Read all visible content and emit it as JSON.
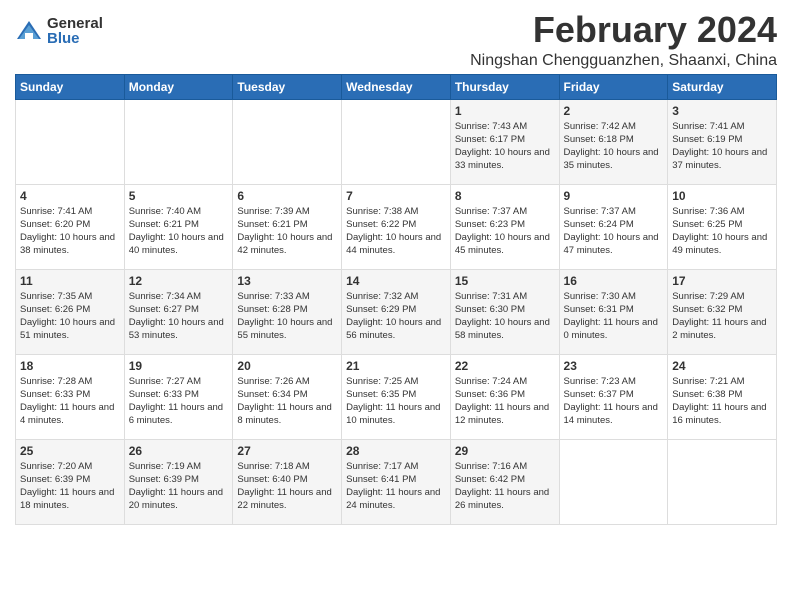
{
  "logo": {
    "general": "General",
    "blue": "Blue"
  },
  "title": "February 2024",
  "location": "Ningshan Chengguanzhen, Shaanxi, China",
  "weekdays": [
    "Sunday",
    "Monday",
    "Tuesday",
    "Wednesday",
    "Thursday",
    "Friday",
    "Saturday"
  ],
  "weeks": [
    [
      {
        "day": "",
        "info": ""
      },
      {
        "day": "",
        "info": ""
      },
      {
        "day": "",
        "info": ""
      },
      {
        "day": "",
        "info": ""
      },
      {
        "day": "1",
        "info": "Sunrise: 7:43 AM\nSunset: 6:17 PM\nDaylight: 10 hours and 33 minutes."
      },
      {
        "day": "2",
        "info": "Sunrise: 7:42 AM\nSunset: 6:18 PM\nDaylight: 10 hours and 35 minutes."
      },
      {
        "day": "3",
        "info": "Sunrise: 7:41 AM\nSunset: 6:19 PM\nDaylight: 10 hours and 37 minutes."
      }
    ],
    [
      {
        "day": "4",
        "info": "Sunrise: 7:41 AM\nSunset: 6:20 PM\nDaylight: 10 hours and 38 minutes."
      },
      {
        "day": "5",
        "info": "Sunrise: 7:40 AM\nSunset: 6:21 PM\nDaylight: 10 hours and 40 minutes."
      },
      {
        "day": "6",
        "info": "Sunrise: 7:39 AM\nSunset: 6:21 PM\nDaylight: 10 hours and 42 minutes."
      },
      {
        "day": "7",
        "info": "Sunrise: 7:38 AM\nSunset: 6:22 PM\nDaylight: 10 hours and 44 minutes."
      },
      {
        "day": "8",
        "info": "Sunrise: 7:37 AM\nSunset: 6:23 PM\nDaylight: 10 hours and 45 minutes."
      },
      {
        "day": "9",
        "info": "Sunrise: 7:37 AM\nSunset: 6:24 PM\nDaylight: 10 hours and 47 minutes."
      },
      {
        "day": "10",
        "info": "Sunrise: 7:36 AM\nSunset: 6:25 PM\nDaylight: 10 hours and 49 minutes."
      }
    ],
    [
      {
        "day": "11",
        "info": "Sunrise: 7:35 AM\nSunset: 6:26 PM\nDaylight: 10 hours and 51 minutes."
      },
      {
        "day": "12",
        "info": "Sunrise: 7:34 AM\nSunset: 6:27 PM\nDaylight: 10 hours and 53 minutes."
      },
      {
        "day": "13",
        "info": "Sunrise: 7:33 AM\nSunset: 6:28 PM\nDaylight: 10 hours and 55 minutes."
      },
      {
        "day": "14",
        "info": "Sunrise: 7:32 AM\nSunset: 6:29 PM\nDaylight: 10 hours and 56 minutes."
      },
      {
        "day": "15",
        "info": "Sunrise: 7:31 AM\nSunset: 6:30 PM\nDaylight: 10 hours and 58 minutes."
      },
      {
        "day": "16",
        "info": "Sunrise: 7:30 AM\nSunset: 6:31 PM\nDaylight: 11 hours and 0 minutes."
      },
      {
        "day": "17",
        "info": "Sunrise: 7:29 AM\nSunset: 6:32 PM\nDaylight: 11 hours and 2 minutes."
      }
    ],
    [
      {
        "day": "18",
        "info": "Sunrise: 7:28 AM\nSunset: 6:33 PM\nDaylight: 11 hours and 4 minutes."
      },
      {
        "day": "19",
        "info": "Sunrise: 7:27 AM\nSunset: 6:33 PM\nDaylight: 11 hours and 6 minutes."
      },
      {
        "day": "20",
        "info": "Sunrise: 7:26 AM\nSunset: 6:34 PM\nDaylight: 11 hours and 8 minutes."
      },
      {
        "day": "21",
        "info": "Sunrise: 7:25 AM\nSunset: 6:35 PM\nDaylight: 11 hours and 10 minutes."
      },
      {
        "day": "22",
        "info": "Sunrise: 7:24 AM\nSunset: 6:36 PM\nDaylight: 11 hours and 12 minutes."
      },
      {
        "day": "23",
        "info": "Sunrise: 7:23 AM\nSunset: 6:37 PM\nDaylight: 11 hours and 14 minutes."
      },
      {
        "day": "24",
        "info": "Sunrise: 7:21 AM\nSunset: 6:38 PM\nDaylight: 11 hours and 16 minutes."
      }
    ],
    [
      {
        "day": "25",
        "info": "Sunrise: 7:20 AM\nSunset: 6:39 PM\nDaylight: 11 hours and 18 minutes."
      },
      {
        "day": "26",
        "info": "Sunrise: 7:19 AM\nSunset: 6:39 PM\nDaylight: 11 hours and 20 minutes."
      },
      {
        "day": "27",
        "info": "Sunrise: 7:18 AM\nSunset: 6:40 PM\nDaylight: 11 hours and 22 minutes."
      },
      {
        "day": "28",
        "info": "Sunrise: 7:17 AM\nSunset: 6:41 PM\nDaylight: 11 hours and 24 minutes."
      },
      {
        "day": "29",
        "info": "Sunrise: 7:16 AM\nSunset: 6:42 PM\nDaylight: 11 hours and 26 minutes."
      },
      {
        "day": "",
        "info": ""
      },
      {
        "day": "",
        "info": ""
      }
    ]
  ]
}
